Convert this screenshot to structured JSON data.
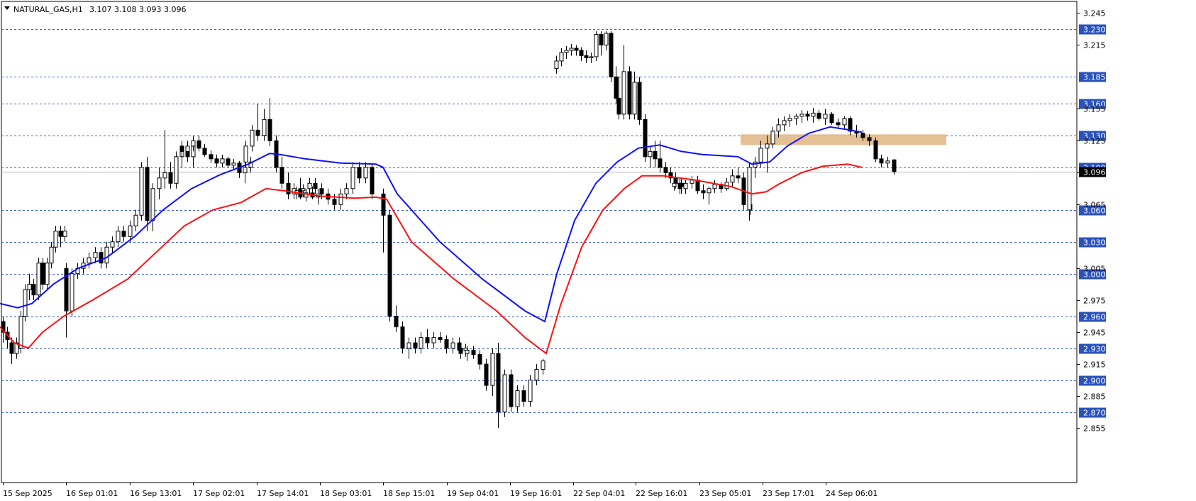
{
  "header": {
    "symbol": "NATURAL_GAS,H1",
    "ohlc": "3.107 3.108 3.093 3.096",
    "menu_icon": "triangle-down-icon"
  },
  "chart_data": {
    "type": "candlestick",
    "symbol": "NATURAL_GAS",
    "timeframe": "H1",
    "ylim": [
      2.845,
      3.252
    ],
    "y_ticks": [
      3.245,
      3.215,
      3.155,
      3.125,
      3.095,
      3.065,
      3.005,
      2.975,
      2.945,
      2.915,
      2.885,
      2.855
    ],
    "x_ticks": [
      "15 Sep 2025",
      "16 Sep 01:01",
      "16 Sep 13:01",
      "17 Sep 02:01",
      "17 Sep 14:01",
      "18 Sep 03:01",
      "18 Sep 15:01",
      "19 Sep 04:01",
      "19 Sep 16:01",
      "22 Sep 04:01",
      "22 Sep 16:01",
      "23 Sep 05:01",
      "23 Sep 17:01",
      "24 Sep 06:01"
    ],
    "current_price": 3.096,
    "horizontal_levels": [
      3.23,
      3.185,
      3.16,
      3.13,
      3.1,
      3.06,
      3.03,
      3.0,
      2.96,
      2.93,
      2.9,
      2.87
    ],
    "zone": {
      "from": 3.121,
      "to": 3.131,
      "color": "#e3b98a"
    },
    "candles": [
      [
        2.955,
        2.96,
        2.935,
        2.945
      ],
      [
        2.945,
        2.95,
        2.93,
        2.938
      ],
      [
        2.935,
        2.94,
        2.915,
        2.925
      ],
      [
        2.925,
        2.94,
        2.92,
        2.935
      ],
      [
        2.93,
        2.965,
        2.925,
        2.96
      ],
      [
        2.96,
        2.99,
        2.955,
        2.985
      ],
      [
        2.985,
        3.0,
        2.975,
        2.99
      ],
      [
        2.99,
        2.995,
        2.975,
        2.98
      ],
      [
        2.98,
        3.015,
        2.975,
        3.01
      ],
      [
        3.01,
        3.015,
        2.985,
        2.99
      ],
      [
        2.99,
        3.015,
        2.985,
        3.01
      ],
      [
        3.01,
        3.03,
        3.005,
        3.025
      ],
      [
        3.025,
        3.045,
        3.02,
        3.04
      ],
      [
        3.04,
        3.045,
        3.025,
        3.035
      ],
      [
        3.035,
        3.045,
        3.03,
        3.04
      ],
      [
        3.005,
        3.01,
        2.94,
        2.965
      ],
      [
        2.965,
        3.005,
        2.96,
        3.0
      ],
      [
        3.0,
        3.01,
        2.995,
        3.005
      ],
      [
        3.005,
        3.015,
        3.0,
        3.01
      ],
      [
        3.01,
        3.02,
        3.005,
        3.015
      ],
      [
        3.015,
        3.025,
        3.01,
        3.02
      ],
      [
        3.02,
        3.025,
        3.005,
        3.01
      ],
      [
        3.01,
        3.03,
        3.005,
        3.025
      ],
      [
        3.025,
        3.035,
        3.02,
        3.03
      ],
      [
        3.03,
        3.045,
        3.025,
        3.04
      ],
      [
        3.04,
        3.045,
        3.03,
        3.035
      ],
      [
        3.035,
        3.05,
        3.03,
        3.045
      ],
      [
        3.045,
        3.06,
        3.04,
        3.055
      ],
      [
        3.055,
        3.105,
        3.05,
        3.1
      ],
      [
        3.1,
        3.11,
        3.04,
        3.05
      ],
      [
        3.05,
        3.085,
        3.04,
        3.08
      ],
      [
        3.08,
        3.1,
        3.07,
        3.09
      ],
      [
        3.09,
        3.135,
        3.08,
        3.095
      ],
      [
        3.095,
        3.105,
        3.08,
        3.085
      ],
      [
        3.085,
        3.115,
        3.08,
        3.11
      ],
      [
        3.11,
        3.12,
        3.1,
        3.115
      ],
      [
        3.115,
        3.12,
        3.105,
        3.11
      ],
      [
        3.11,
        3.125,
        3.1,
        3.12
      ],
      [
        3.12,
        3.125,
        3.11,
        3.115
      ],
      [
        3.115,
        3.125,
        3.11,
        3.12
      ],
      [
        3.12,
        3.13,
        3.115,
        3.125
      ],
      [
        3.125,
        3.13,
        3.115,
        3.118
      ],
      [
        3.118,
        3.122,
        3.11,
        3.112
      ],
      [
        3.112,
        3.116,
        3.104,
        3.108
      ],
      [
        3.108,
        3.112,
        3.1,
        3.104
      ],
      [
        3.104,
        3.112,
        3.1,
        3.108
      ],
      [
        3.108,
        3.11,
        3.1,
        3.102
      ],
      [
        3.102,
        3.108,
        3.098,
        3.104
      ],
      [
        3.104,
        3.106,
        3.09,
        3.095
      ],
      [
        3.095,
        3.105,
        3.085,
        3.1
      ],
      [
        3.1,
        3.11,
        3.095,
        3.105
      ],
      [
        3.105,
        3.125,
        3.1,
        3.12
      ],
      [
        3.12,
        3.14,
        3.115,
        3.135
      ],
      [
        3.135,
        3.16,
        3.125,
        3.13
      ],
      [
        3.13,
        3.155,
        3.125,
        3.145
      ],
      [
        3.145,
        3.165,
        3.12,
        3.125
      ],
      [
        3.125,
        3.13,
        3.095,
        3.1
      ],
      [
        3.1,
        3.11,
        3.08,
        3.085
      ],
      [
        3.085,
        3.095,
        3.07,
        3.075
      ],
      [
        3.075,
        3.085,
        3.07,
        3.08
      ],
      [
        3.08,
        3.09,
        3.07,
        3.072
      ],
      [
        3.072,
        3.08,
        3.068,
        3.076
      ],
      [
        3.076,
        3.082,
        3.07,
        3.072
      ],
      [
        3.072,
        3.08,
        3.065,
        3.075
      ],
      [
        3.075,
        3.082,
        3.07,
        3.078
      ],
      [
        3.078,
        3.084,
        3.072,
        3.08
      ],
      [
        3.08,
        3.09,
        3.075,
        3.085
      ],
      [
        3.085,
        3.09,
        3.075,
        3.08
      ],
      [
        3.08,
        3.085,
        3.07,
        3.075
      ],
      [
        3.075,
        3.08,
        3.065,
        3.07
      ],
      [
        3.07,
        3.075,
        3.06,
        3.065
      ],
      [
        3.065,
        3.08,
        3.06,
        3.075
      ],
      [
        3.075,
        3.085,
        3.07,
        3.08
      ],
      [
        3.08,
        3.105,
        3.075,
        3.1
      ],
      [
        3.1,
        3.105,
        3.085,
        3.09
      ],
      [
        3.09,
        3.105,
        3.085,
        3.1
      ],
      [
        3.1,
        3.104,
        3.07,
        3.075
      ],
      [
        3.075,
        3.08,
        3.02,
        3.055
      ],
      [
        3.055,
        3.06,
        2.955,
        2.96
      ],
      [
        2.96,
        2.97,
        2.945,
        2.95
      ],
      [
        2.95,
        2.955,
        2.925,
        2.93
      ],
      [
        2.93,
        2.94,
        2.92,
        2.935
      ],
      [
        2.935,
        2.94,
        2.925,
        2.93
      ],
      [
        2.93,
        2.945,
        2.925,
        2.94
      ],
      [
        2.94,
        2.948,
        2.93,
        2.935
      ],
      [
        2.935,
        2.945,
        2.93,
        2.94
      ],
      [
        2.94,
        2.945,
        2.935,
        2.938
      ],
      [
        2.938,
        2.942,
        2.925,
        2.93
      ],
      [
        2.93,
        2.94,
        2.925,
        2.935
      ],
      [
        2.935,
        2.94,
        2.925,
        2.928
      ],
      [
        2.928,
        2.934,
        2.922,
        2.93
      ],
      [
        2.93,
        2.935,
        2.92,
        2.925
      ],
      [
        2.925,
        2.932,
        2.918,
        2.928
      ],
      [
        2.928,
        2.932,
        2.92,
        2.924
      ],
      [
        2.924,
        2.928,
        2.91,
        2.915
      ],
      [
        2.915,
        2.92,
        2.89,
        2.895
      ],
      [
        2.895,
        2.93,
        2.885,
        2.925
      ],
      [
        2.925,
        2.935,
        2.855,
        2.87
      ],
      [
        2.87,
        2.91,
        2.865,
        2.905
      ],
      [
        2.905,
        2.91,
        2.87,
        2.875
      ],
      [
        2.875,
        2.895,
        2.87,
        2.89
      ],
      [
        2.89,
        2.895,
        2.875,
        2.88
      ],
      [
        2.88,
        2.905,
        2.875,
        2.9
      ],
      [
        2.9,
        2.915,
        2.895,
        2.91
      ],
      [
        2.91,
        2.92,
        2.905,
        2.918
      ],
      [
        3.193,
        3.205,
        3.188,
        3.2
      ],
      [
        3.2,
        3.212,
        3.195,
        3.208
      ],
      [
        3.208,
        3.214,
        3.202,
        3.21
      ],
      [
        3.21,
        3.216,
        3.205,
        3.212
      ],
      [
        3.212,
        3.215,
        3.205,
        3.21
      ],
      [
        3.21,
        3.213,
        3.2,
        3.205
      ],
      [
        3.205,
        3.21,
        3.198,
        3.203
      ],
      [
        3.203,
        3.208,
        3.198,
        3.204
      ],
      [
        3.204,
        3.228,
        3.2,
        3.225
      ],
      [
        3.225,
        3.228,
        3.205,
        3.215
      ],
      [
        3.215,
        3.228,
        3.21,
        3.226
      ],
      [
        3.226,
        3.228,
        3.18,
        3.185
      ],
      [
        3.185,
        3.195,
        3.16,
        3.165
      ],
      [
        3.165,
        3.185,
        3.145,
        3.15
      ],
      [
        3.15,
        3.215,
        3.145,
        3.19
      ],
      [
        3.19,
        3.195,
        3.145,
        3.15
      ],
      [
        3.15,
        3.19,
        3.145,
        3.18
      ],
      [
        3.18,
        3.185,
        3.14,
        3.145
      ],
      [
        3.145,
        3.15,
        3.105,
        3.11
      ],
      [
        3.11,
        3.12,
        3.1,
        3.115
      ],
      [
        3.115,
        3.125,
        3.1,
        3.108
      ],
      [
        3.108,
        3.125,
        3.095,
        3.1
      ],
      [
        3.1,
        3.105,
        3.09,
        3.095
      ],
      [
        3.095,
        3.1,
        3.085,
        3.09
      ],
      [
        3.09,
        3.095,
        3.08,
        3.085
      ],
      [
        3.085,
        3.09,
        3.075,
        3.082
      ],
      [
        3.082,
        3.09,
        3.078,
        3.085
      ],
      [
        3.085,
        3.09,
        3.075,
        3.08
      ],
      [
        3.08,
        3.088,
        3.075,
        3.085
      ],
      [
        3.085,
        3.092,
        3.08,
        3.088
      ],
      [
        3.088,
        3.092,
        3.075,
        3.078
      ],
      [
        3.078,
        3.084,
        3.07,
        3.076
      ],
      [
        3.076,
        3.082,
        3.065,
        3.08
      ],
      [
        3.08,
        3.088,
        3.076,
        3.084
      ],
      [
        3.084,
        3.086,
        3.076,
        3.08
      ],
      [
        3.08,
        3.09,
        3.078,
        3.086
      ],
      [
        3.086,
        3.098,
        3.082,
        3.092
      ],
      [
        3.092,
        3.1,
        3.085,
        3.09
      ],
      [
        3.09,
        3.095,
        3.06,
        3.065
      ],
      [
        3.065,
        3.07,
        3.055,
        3.06
      ],
      [
        3.06,
        3.105,
        3.05,
        3.1
      ],
      [
        3.1,
        3.11,
        3.09,
        3.105
      ],
      [
        3.105,
        3.125,
        3.1,
        3.118
      ],
      [
        3.118,
        3.13,
        3.095,
        3.122
      ],
      [
        3.122,
        3.138,
        3.118,
        3.134
      ],
      [
        3.134,
        3.146,
        3.128,
        3.14
      ],
      [
        3.14,
        3.148,
        3.134,
        3.144
      ],
      [
        3.144,
        3.15,
        3.138,
        3.146
      ],
      [
        3.146,
        3.15,
        3.14,
        3.148
      ],
      [
        3.148,
        3.154,
        3.142,
        3.15
      ],
      [
        3.15,
        3.153,
        3.144,
        3.148
      ],
      [
        3.148,
        3.156,
        3.142,
        3.151
      ],
      [
        3.151,
        3.154,
        3.144,
        3.146
      ],
      [
        3.146,
        3.155,
        3.14,
        3.15
      ],
      [
        3.15,
        3.152,
        3.14,
        3.142
      ],
      [
        3.142,
        3.146,
        3.136,
        3.14
      ],
      [
        3.14,
        3.148,
        3.136,
        3.146
      ],
      [
        3.146,
        3.148,
        3.13,
        3.134
      ],
      [
        3.134,
        3.14,
        3.128,
        3.132
      ],
      [
        3.132,
        3.135,
        3.125,
        3.128
      ],
      [
        3.128,
        3.131,
        3.12,
        3.125
      ],
      [
        3.125,
        3.128,
        3.105,
        3.108
      ],
      [
        3.108,
        3.112,
        3.1,
        3.104
      ],
      [
        3.104,
        3.11,
        3.1,
        3.106
      ],
      [
        3.107,
        3.108,
        3.093,
        3.096
      ]
    ],
    "ma_blue": [
      [
        0,
        2.972
      ],
      [
        25,
        2.968
      ],
      [
        45,
        2.972
      ],
      [
        75,
        2.99
      ],
      [
        110,
        3.005
      ],
      [
        150,
        3.015
      ],
      [
        190,
        3.035
      ],
      [
        230,
        3.06
      ],
      [
        270,
        3.08
      ],
      [
        310,
        3.093
      ],
      [
        350,
        3.103
      ],
      [
        380,
        3.113
      ],
      [
        395,
        3.112
      ],
      [
        430,
        3.108
      ],
      [
        480,
        3.104
      ],
      [
        530,
        3.103
      ],
      [
        540,
        3.1
      ],
      [
        560,
        3.075
      ],
      [
        620,
        3.03
      ],
      [
        680,
        2.995
      ],
      [
        740,
        2.965
      ],
      [
        768,
        2.955
      ],
      [
        785,
        3.0
      ],
      [
        810,
        3.05
      ],
      [
        840,
        3.085
      ],
      [
        870,
        3.105
      ],
      [
        900,
        3.118
      ],
      [
        930,
        3.121
      ],
      [
        960,
        3.115
      ],
      [
        990,
        3.112
      ],
      [
        1040,
        3.11
      ],
      [
        1060,
        3.103
      ],
      [
        1085,
        3.105
      ],
      [
        1110,
        3.12
      ],
      [
        1140,
        3.132
      ],
      [
        1170,
        3.138
      ],
      [
        1190,
        3.136
      ],
      [
        1215,
        3.133
      ]
    ],
    "ma_red": [
      [
        0,
        2.95
      ],
      [
        20,
        2.935
      ],
      [
        40,
        2.93
      ],
      [
        60,
        2.945
      ],
      [
        90,
        2.96
      ],
      [
        130,
        2.975
      ],
      [
        180,
        2.995
      ],
      [
        220,
        3.02
      ],
      [
        260,
        3.045
      ],
      [
        300,
        3.06
      ],
      [
        340,
        3.067
      ],
      [
        375,
        3.08
      ],
      [
        400,
        3.078
      ],
      [
        450,
        3.073
      ],
      [
        500,
        3.071
      ],
      [
        530,
        3.072
      ],
      [
        545,
        3.07
      ],
      [
        580,
        3.03
      ],
      [
        640,
        2.995
      ],
      [
        700,
        2.965
      ],
      [
        740,
        2.94
      ],
      [
        770,
        2.925
      ],
      [
        790,
        2.97
      ],
      [
        820,
        3.025
      ],
      [
        850,
        3.06
      ],
      [
        880,
        3.08
      ],
      [
        905,
        3.092
      ],
      [
        935,
        3.092
      ],
      [
        980,
        3.088
      ],
      [
        1030,
        3.082
      ],
      [
        1060,
        3.075
      ],
      [
        1080,
        3.077
      ],
      [
        1100,
        3.085
      ],
      [
        1130,
        3.095
      ],
      [
        1160,
        3.101
      ],
      [
        1195,
        3.103
      ],
      [
        1215,
        3.1
      ]
    ]
  }
}
